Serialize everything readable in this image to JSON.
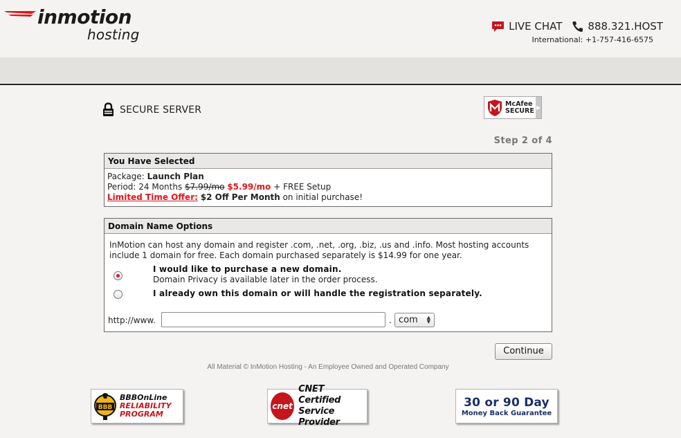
{
  "header": {
    "brand": "inmotion",
    "brand_sub": "hosting",
    "live_chat": "LIVE CHAT",
    "phone": "888.321.HOST",
    "international": "International: +1-757-416-6575"
  },
  "secure": {
    "label": "SECURE SERVER",
    "mcafee_l1": "McAfee",
    "mcafee_l2": "SECURE"
  },
  "step": "Step 2 of 4",
  "selected": {
    "heading": "You Have Selected",
    "package_label": "Package: ",
    "package_value": "Launch Plan",
    "period_label": "Period: 24 Months ",
    "old_price": "$7.99/mo",
    "new_price": "$5.99/mo",
    "setup": " + FREE Setup",
    "offer_label": "Limited Time Offer:",
    "offer_value": "$2 Off Per Month",
    "offer_rest": " on initial purchase!"
  },
  "domain": {
    "heading": "Domain Name Options",
    "description": "InMotion can host any domain and register .com, .net, .org, .biz, .us and .info. Most hosting accounts include 1 domain for free. Each domain purchased separately is $14.99 for one year.",
    "option1_title": "I would like to purchase a new domain.",
    "option1_sub": "Domain Privacy is available later in the order process.",
    "option2_title": "I already own this domain or will handle the registration separately.",
    "prefix": "http://www.",
    "input_value": "",
    "dot": ".",
    "tld": "com",
    "selected_option": 1
  },
  "continue_label": "Continue",
  "footer": "All Material © InMotion Hosting - An Employee Owned and Operated Company",
  "badges": {
    "bbb_l1": "BBBOnLine",
    "bbb_l2": "RELIABILITY",
    "bbb_l3": "PROGRAM",
    "bbb_icon": "BBB",
    "cnet_logo": "cnet",
    "cnet_l1": "CNET Certified",
    "cnet_l2": "Service Provider",
    "money_l1": "30 or 90 Day",
    "money_l2": "Money Back Guarantee"
  },
  "colors": {
    "accent_red": "#e0161b",
    "navy": "#1b2e6b"
  }
}
